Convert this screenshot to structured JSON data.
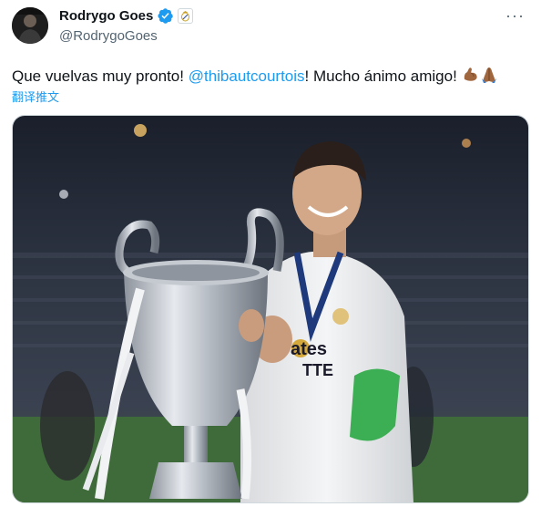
{
  "user": {
    "display_name": "Rodrygo Goes",
    "handle": "@RodrygoGoes"
  },
  "tweet": {
    "text_before": "Que vuelvas muy pronto! ",
    "mention": "@thibautcourtois",
    "text_after": "! Mucho ánimo amigo! ",
    "emojis": "💪🏽🙏🏽",
    "translate_label": "翻译推文"
  },
  "media": {
    "alt": "Player in white jersey holding a large silver trophy in a stadium",
    "jersey_text_line1": "ates",
    "jersey_text_line2": "TTE"
  },
  "icons": {
    "verified": "verified-badge-icon",
    "affiliation": "club-crest-icon",
    "more": "more-options-icon"
  },
  "colors": {
    "accent": "#1d9bf0",
    "secondary_text": "#536471",
    "primary_text": "#0f1419"
  }
}
